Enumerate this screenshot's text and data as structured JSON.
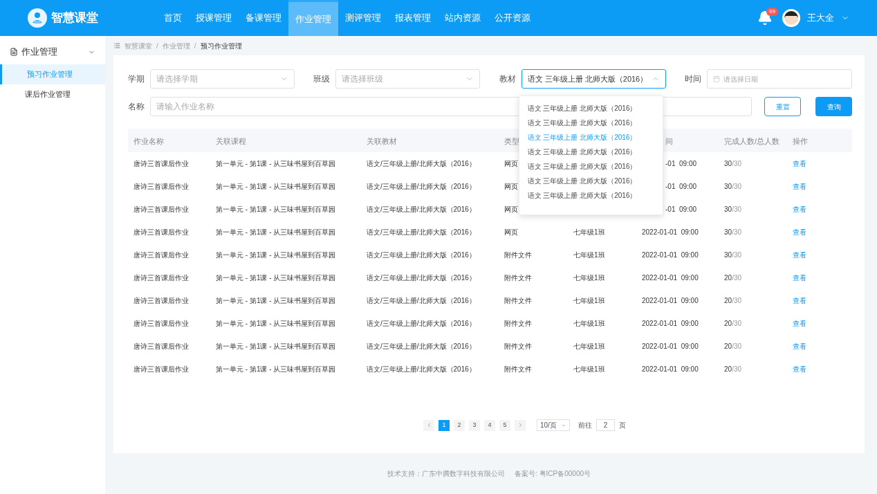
{
  "app": {
    "title": "智慧课堂"
  },
  "nav": [
    {
      "label": "首页",
      "selected": false
    },
    {
      "label": "授课管理",
      "selected": false
    },
    {
      "label": "备课管理",
      "selected": false
    },
    {
      "label": "作业管理",
      "selected": true
    },
    {
      "label": "测评管理",
      "selected": false
    },
    {
      "label": "报表管理",
      "selected": false
    },
    {
      "label": "站内资源",
      "selected": false
    },
    {
      "label": "公开资源",
      "selected": false
    }
  ],
  "user": {
    "notifications": "99",
    "name": "王大全"
  },
  "sidebar": {
    "group": {
      "label": "作业管理",
      "expanded": true
    },
    "items": [
      {
        "label": "预习作业管理",
        "selected": true
      },
      {
        "label": "课后作业管理",
        "selected": false
      }
    ]
  },
  "breadcrumb": {
    "separator": "/",
    "items": [
      "智慧课堂",
      "作业管理",
      "预习作业管理"
    ]
  },
  "filters": {
    "term": {
      "label": "学期",
      "placeholder": "请选择学期"
    },
    "class": {
      "label": "班级",
      "placeholder": "请选择班级"
    },
    "textbook": {
      "label": "教材",
      "value": "语文 三年级上册 北师大版（2016）",
      "expanded": true
    },
    "time": {
      "label": "时间",
      "placeholder": "请选择日期"
    },
    "name": {
      "label": "名称",
      "placeholder": "请输入作业名称"
    }
  },
  "textbook_options": [
    {
      "label": "语文 三年级上册 北师大版（2016）",
      "selected": false
    },
    {
      "label": "语文 三年级上册 北师大版（2016）",
      "selected": false
    },
    {
      "label": "语文 三年级上册 北师大版（2016）",
      "selected": true
    },
    {
      "label": "语文 三年级上册 北师大版（2016）",
      "selected": false
    },
    {
      "label": "语文 三年级上册 北师大版（2016）",
      "selected": false
    },
    {
      "label": "语文 三年级上册 北师大版（2016）",
      "selected": false
    },
    {
      "label": "语文 三年级上册 北师大版（2016）",
      "selected": false
    }
  ],
  "buttons": {
    "reset": "重置",
    "search": "查询"
  },
  "table": {
    "columns": [
      {
        "kind": "full",
        "label": "作业名称"
      },
      {
        "kind": "full",
        "label": "关联课程"
      },
      {
        "kind": "full",
        "label": "关联教材"
      },
      {
        "kind": "full",
        "label": "类型"
      },
      {
        "kind": "covered"
      },
      {
        "kind": "cut",
        "label": "间"
      },
      {
        "kind": "full",
        "label": "完成人数/总人数"
      },
      {
        "kind": "full",
        "label": "操作"
      }
    ],
    "rows": [
      {
        "name": "唐诗三首课后作业",
        "course": "第一单元 - 第1课 - 从三味书屋到百草园",
        "textbook": "语文/三年级上册/北师大版（2016）",
        "type": "网页",
        "time": {
          "kind": "cut",
          "text": "-01  09:00"
        },
        "done": "30",
        "total": "/30",
        "action": "查看"
      },
      {
        "name": "唐诗三首课后作业",
        "course": "第一单元 - 第1课 - 从三味书屋到百草园",
        "textbook": "语文/三年级上册/北师大版（2016）",
        "type": "网页",
        "time": {
          "kind": "cut",
          "text": "-01  09:00"
        },
        "done": "30",
        "total": "/30",
        "action": "查看"
      },
      {
        "name": "唐诗三首课后作业",
        "course": "第一单元 - 第1课 - 从三味书屋到百草园",
        "textbook": "语文/三年级上册/北师大版（2016）",
        "type": "网页",
        "time": {
          "kind": "cut",
          "text": "-01  09:00"
        },
        "done": "30",
        "total": "/30",
        "action": "查看"
      },
      {
        "name": "唐诗三首课后作业",
        "course": "第一单元 - 第1课 - 从三味书屋到百草园",
        "textbook": "语文/三年级上册/北师大版（2016）",
        "type": "网页",
        "class_name": "七年级1班",
        "time": {
          "kind": "full",
          "text": "2022-01-01  09:00"
        },
        "done": "30",
        "total": "/30",
        "action": "查看"
      },
      {
        "name": "唐诗三首课后作业",
        "course": "第一单元 - 第1课 - 从三味书屋到百草园",
        "textbook": "语文/三年级上册/北师大版（2016）",
        "type": "附件文件",
        "class_name": "七年级1班",
        "time": {
          "kind": "full",
          "text": "2022-01-01  09:00"
        },
        "done": "30",
        "total": "/30",
        "action": "查看"
      },
      {
        "name": "唐诗三首课后作业",
        "course": "第一单元 - 第1课 - 从三味书屋到百草园",
        "textbook": "语文/三年级上册/北师大版（2016）",
        "type": "附件文件",
        "class_name": "七年级1班",
        "time": {
          "kind": "full",
          "text": "2022-01-01  09:00"
        },
        "done": "20",
        "total": "/30",
        "action": "查看"
      },
      {
        "name": "唐诗三首课后作业",
        "course": "第一单元 - 第1课 - 从三味书屋到百草园",
        "textbook": "语文/三年级上册/北师大版（2016）",
        "type": "附件文件",
        "class_name": "七年级1班",
        "time": {
          "kind": "full",
          "text": "2022-01-01  09:00"
        },
        "done": "20",
        "total": "/30",
        "action": "查看"
      },
      {
        "name": "唐诗三首课后作业",
        "course": "第一单元 - 第1课 - 从三味书屋到百草园",
        "textbook": "语文/三年级上册/北师大版（2016）",
        "type": "附件文件",
        "class_name": "七年级1班",
        "time": {
          "kind": "full",
          "text": "2022-01-01  09:00"
        },
        "done": "20",
        "total": "/30",
        "action": "查看"
      },
      {
        "name": "唐诗三首课后作业",
        "course": "第一单元 - 第1课 - 从三味书屋到百草园",
        "textbook": "语文/三年级上册/北师大版（2016）",
        "type": "附件文件",
        "class_name": "七年级1班",
        "time": {
          "kind": "full",
          "text": "2022-01-01  09:00"
        },
        "done": "20",
        "total": "/30",
        "action": "查看"
      },
      {
        "name": "唐诗三首课后作业",
        "course": "第一单元 - 第1课 - 从三味书屋到百草园",
        "textbook": "语文/三年级上册/北师大版（2016）",
        "type": "附件文件",
        "class_name": "七年级1班",
        "time": {
          "kind": "full",
          "text": "2022-01-01  09:00"
        },
        "done": "20",
        "total": "/30",
        "action": "查看"
      }
    ]
  },
  "pagination": {
    "pages": [
      {
        "label": "1",
        "selected": true
      },
      {
        "label": "2",
        "selected": false
      },
      {
        "label": "3",
        "selected": false
      },
      {
        "label": "4",
        "selected": false
      },
      {
        "label": "5",
        "selected": false
      }
    ],
    "page_size": "10/页",
    "goto_label": "前往",
    "goto_value": "2",
    "goto_suffix": "页"
  },
  "footer": {
    "support": "技术支持：广东中腾数字科技有限公司",
    "icp": "备案号: 粤ICP备00000号"
  }
}
